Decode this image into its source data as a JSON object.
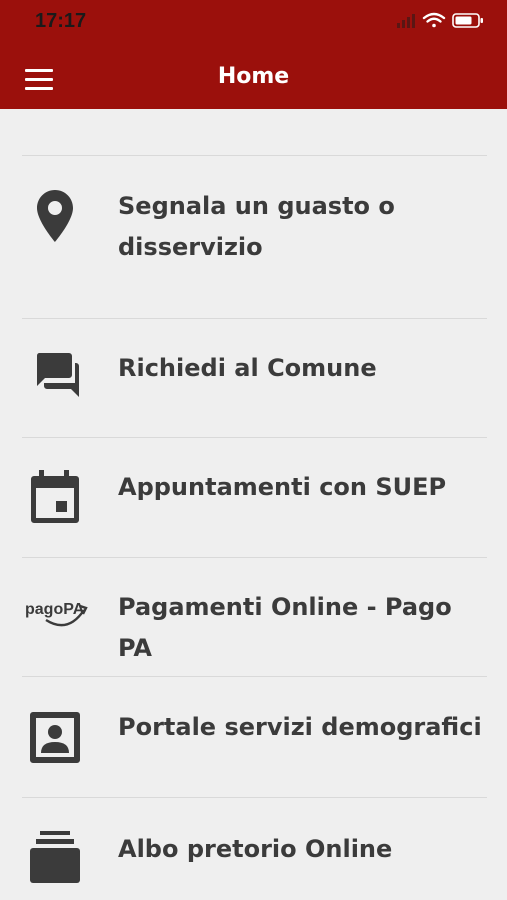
{
  "status": {
    "time": "17:17"
  },
  "header": {
    "title": "Home"
  },
  "items": [
    {
      "label": "Segnala un guasto o disservizio",
      "icon": "location-pin-icon"
    },
    {
      "label": "Richiedi al Comune",
      "icon": "chat-bubbles-icon"
    },
    {
      "label": "Appuntamenti con SUEP",
      "icon": "calendar-icon"
    },
    {
      "label": "Pagamenti Online - Pago PA",
      "icon": "pagopa-logo-icon",
      "logo_text": "pagoPA"
    },
    {
      "label": "Portale servizi demografici",
      "icon": "contact-card-icon"
    },
    {
      "label": "Albo pretorio Online",
      "icon": "archive-stack-icon"
    }
  ],
  "colors": {
    "header": "#9b100c",
    "background": "#efefef",
    "text": "#3b3b3b"
  }
}
